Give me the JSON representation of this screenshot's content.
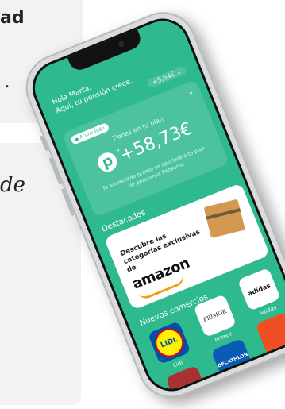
{
  "background": {
    "fragment_top": "ad",
    "fragment_period": ".",
    "fragment_de": "de"
  },
  "app": {
    "greeting_line1": "Hola Marta,",
    "greeting_line2": "Aquí, tu pensión crece.",
    "balance_chip": "+5,64€ ⌄",
    "badge_label": "Acumulado",
    "plan_label": "Tienes en tu plan",
    "plan_amount": "+58,73€",
    "plan_description": "Tu acumulado pronto se aportará a tu plan de pensiones Pensumo",
    "featured_title": "Destacados",
    "amazon_text": "Descubre las categorías exclusivas de",
    "amazon_logo": "amazon",
    "new_merchants_title": "Nuevos comercios",
    "merchants": [
      {
        "name": "Lidl",
        "logo_text": "LIDL"
      },
      {
        "name": "Primor",
        "logo_text": "PRIMOR"
      },
      {
        "name": "Adidas",
        "logo_text": "adidas"
      },
      {
        "name": "",
        "logo_text": ""
      },
      {
        "name": "",
        "logo_text": "DECATHLON"
      },
      {
        "name": "",
        "logo_text": ""
      }
    ]
  },
  "colors": {
    "brand_green": "#2fb98f",
    "amazon_orange": "#f39c12"
  }
}
